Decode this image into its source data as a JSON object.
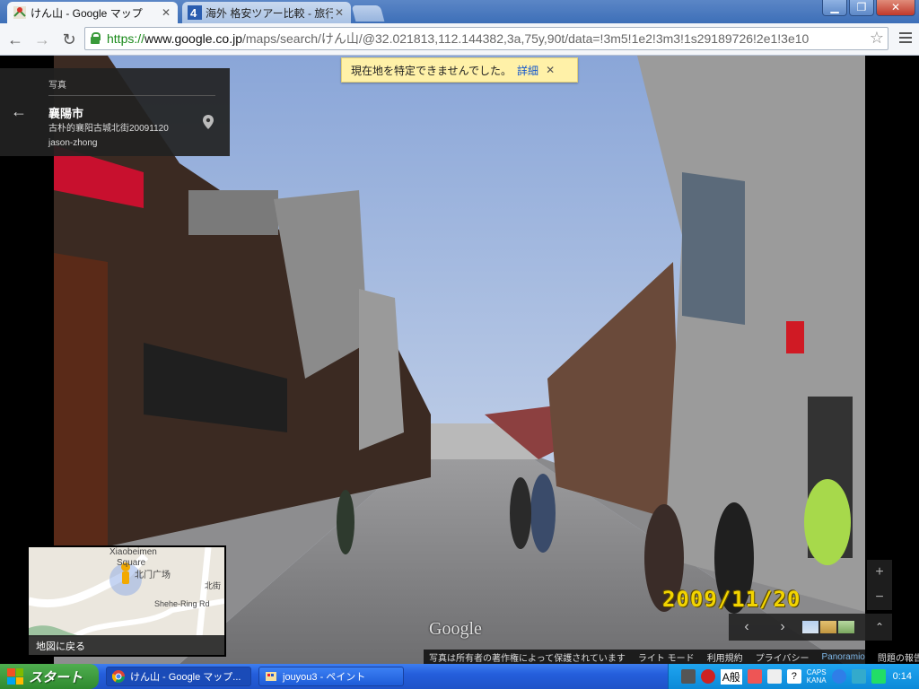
{
  "browser": {
    "tabs": [
      {
        "title": "けん山 - Google マップ",
        "active": true
      },
      {
        "title": "海外 格安ツアー比較 - 旅行",
        "active": false
      }
    ],
    "address": {
      "scheme": "https://",
      "host": "www.google.co.jp",
      "path": "/maps/search/けん山/@32.021813,112.144382,3a,75y,90t/data=!3m5!1e2!3m3!1s29189726!2e1!3e10"
    }
  },
  "map": {
    "notification": {
      "text": "現在地を特定できませんでした。",
      "link": "詳細"
    },
    "infocard": {
      "category": "写真",
      "title": "襄陽市",
      "description": "古朴的襄阳古城北街20091120",
      "author": "jason-zhong"
    },
    "minimap": {
      "label": "地図に戻る",
      "place_labels": [
        "Xiaobeimen",
        "Square",
        "北门广场",
        "北街",
        "Shehe-Ring Rd"
      ]
    },
    "datestamp": "2009/11/20",
    "watermark": "Google",
    "zoom": {
      "in": "+",
      "out": "−"
    },
    "footer": [
      "写真は所有者の著作権によって保護されています",
      "ライト モード",
      "利用規約",
      "プライバシー",
      "Panoramio",
      "問題の報告"
    ]
  },
  "taskbar": {
    "start_label": "スタート",
    "items": [
      {
        "label": "けん山 - Google マップ..."
      },
      {
        "label": "jouyou3 - ペイント"
      }
    ],
    "ime": "A般",
    "caps_kana": [
      "CAPS",
      "KANA"
    ],
    "clock": "0:14"
  },
  "colors": {
    "toast_bg": "#fff1a8",
    "datestamp": "#f2d400",
    "taskbar": "#245edc",
    "start": "#2f8a2f"
  }
}
